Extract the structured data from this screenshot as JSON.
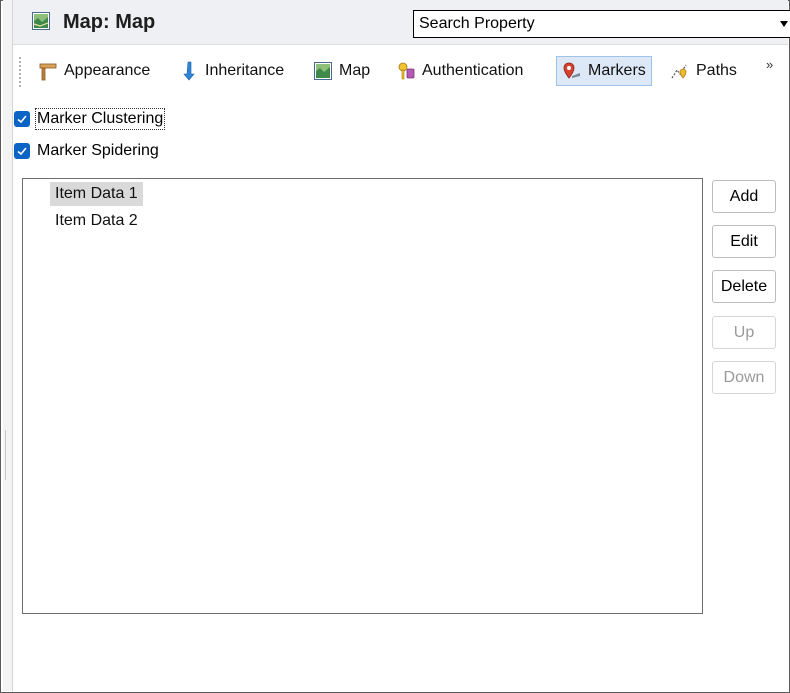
{
  "header": {
    "title": "Map: Map",
    "search_placeholder": "Search Property"
  },
  "tabs": [
    {
      "label": "Appearance",
      "icon": "appearance-icon",
      "active": false
    },
    {
      "label": "Inheritance",
      "icon": "inheritance-icon",
      "active": false
    },
    {
      "label": "Map",
      "icon": "map-icon",
      "active": false
    },
    {
      "label": "Authentication",
      "icon": "authentication-icon",
      "active": false
    },
    {
      "label": "Markers",
      "icon": "marker-icon",
      "active": true
    },
    {
      "label": "Paths",
      "icon": "paths-icon",
      "active": false
    }
  ],
  "more_glyph": "»",
  "options": [
    {
      "label": "Marker Clustering",
      "checked": true
    },
    {
      "label": "Marker Spidering",
      "checked": true
    }
  ],
  "list": {
    "items": [
      "Item Data 1",
      "Item Data 2"
    ],
    "selected_index": 0
  },
  "buttons": {
    "add": "Add",
    "edit": "Edit",
    "delete": "Delete",
    "up": "Up",
    "down": "Down"
  },
  "colors": {
    "accent": "#0a64c6",
    "active_tab_bg": "#dce8f6",
    "header_bg": "#eef0f3"
  }
}
